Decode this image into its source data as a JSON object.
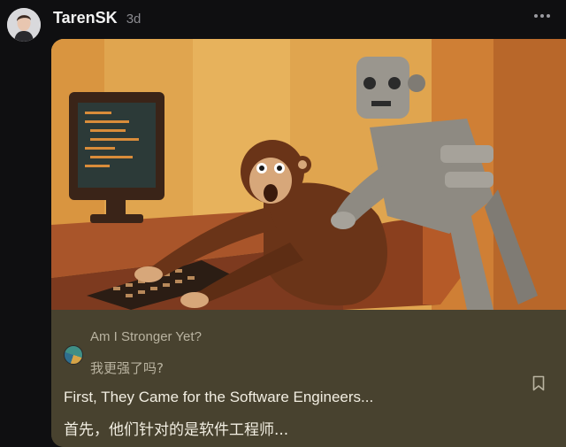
{
  "post": {
    "author": "TarenSK",
    "time": "3d"
  },
  "card": {
    "source_title": "Am I Stronger Yet?",
    "source_title_cn": "我更强了吗?",
    "headline": "First, They Came for the Software Engineers...",
    "headline_cn": "首先，他们针对的是软件工程师..."
  },
  "icons": {
    "avatar": "avatar",
    "more": "more-icon",
    "source": "source-logo-icon",
    "bookmark": "bookmark-icon"
  },
  "colors": {
    "background": "#0f0f11",
    "card_footer": "#48422f",
    "illustration_bg": "#e0a54f"
  }
}
